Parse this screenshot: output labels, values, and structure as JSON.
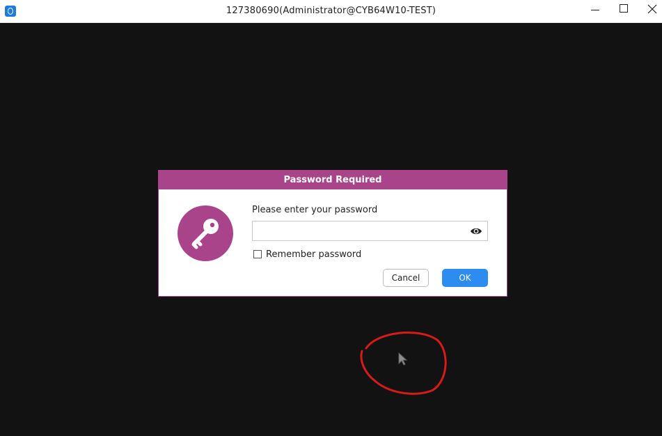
{
  "window": {
    "title": "127380690(Administrator@CYB64W10-TEST)",
    "controls": [
      "minimize-icon",
      "maximize-icon",
      "close-icon"
    ]
  },
  "dialog": {
    "title": "Password Required",
    "icon": "key-icon",
    "prompt": "Please enter your password",
    "password_value": "",
    "password_placeholder": "",
    "show_password_icon": "eye-icon",
    "remember_label": "Remember password",
    "remember_checked": false,
    "cancel_label": "Cancel",
    "ok_label": "OK"
  },
  "colors": {
    "accent": "#aa448a",
    "primary_button": "#2d8cf0",
    "remote_background": "#121212",
    "annotation": "#d71a1a"
  }
}
